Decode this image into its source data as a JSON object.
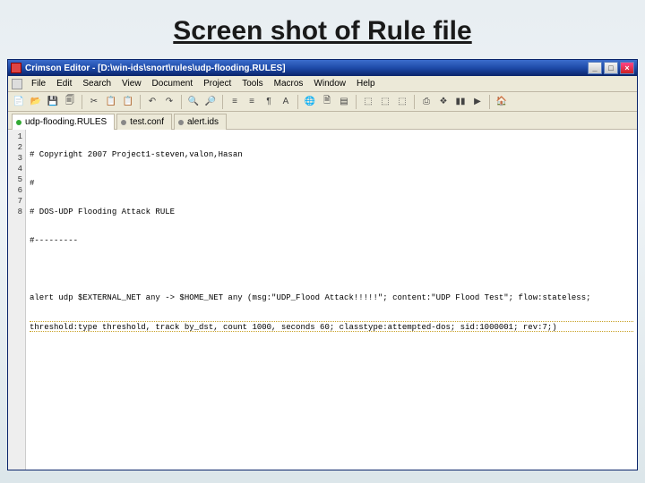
{
  "slide": {
    "title": "Screen shot of Rule file"
  },
  "titlebar": {
    "text": "Crimson Editor - [D:\\win-ids\\snort\\rules\\udp-flooding.RULES]",
    "min": "_",
    "max": "□",
    "close": "×"
  },
  "menus": [
    "File",
    "Edit",
    "Search",
    "View",
    "Document",
    "Project",
    "Tools",
    "Macros",
    "Window",
    "Help"
  ],
  "toolbar_icons": [
    "📄",
    "📂",
    "💾",
    "🗐",
    "✂",
    "📋",
    "📋",
    "↶",
    "↷",
    "🔍",
    "🔎",
    "≡",
    "≡",
    "¶",
    "A",
    "🌐",
    "🗎",
    "▤",
    "⬚",
    "⬚",
    "⬚",
    "⎙",
    "❖",
    "▮▮",
    "▶",
    "🏠"
  ],
  "tabs": [
    {
      "label": "udp-flooding.RULES",
      "active": true,
      "dot": "g"
    },
    {
      "label": "test.conf",
      "active": false,
      "dot": "b"
    },
    {
      "label": "alert.ids",
      "active": false,
      "dot": "b"
    }
  ],
  "line_numbers": [
    "1",
    "2",
    "3",
    "4",
    "5",
    "6",
    "7",
    "8"
  ],
  "code_lines": [
    "# Copyright 2007 Project1-steven,valon,Hasan",
    "#",
    "# DOS-UDP Flooding Attack RULE",
    "#---------",
    "",
    "alert udp $EXTERNAL_NET any -> $HOME_NET any (msg:\"UDP_Flood Attack!!!!!\"; content:\"UDP Flood Test\"; flow:stateless;",
    "threshold:type threshold, track by_dst, count 1000, seconds 60; classtype:attempted-dos; sid:1000001; rev:7;)",
    ""
  ]
}
